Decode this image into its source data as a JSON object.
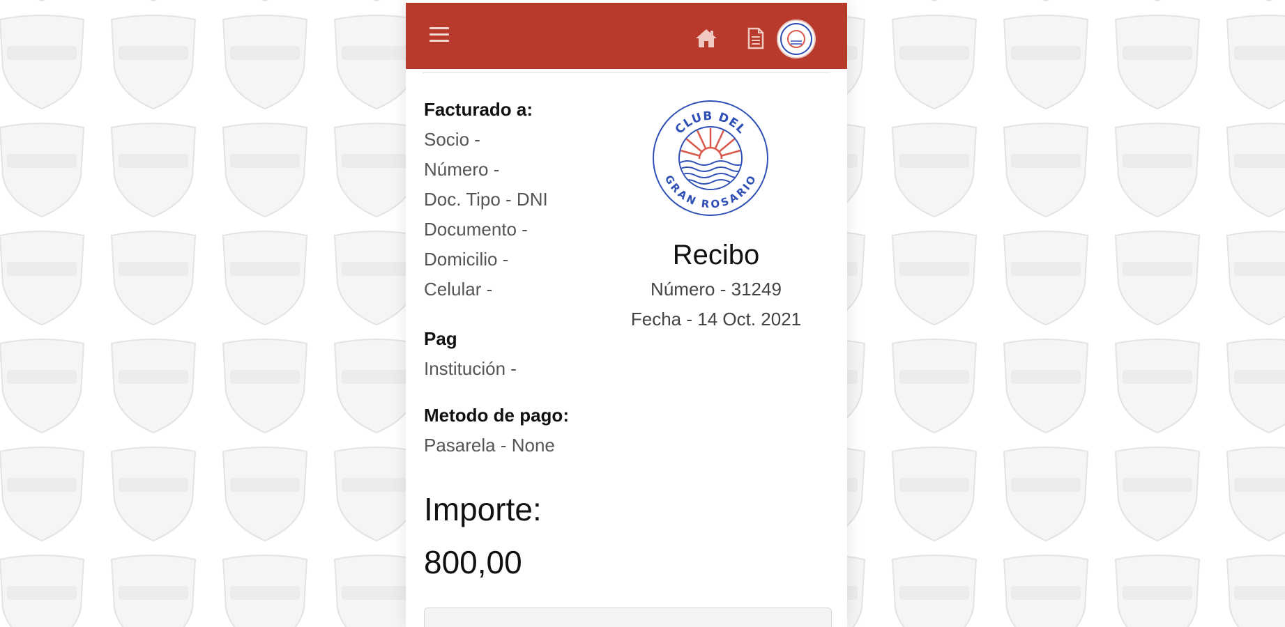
{
  "header": {
    "menu_icon": "hamburger-menu-icon",
    "home_icon": "home-icon",
    "document_icon": "document-icon",
    "avatar_icon": "club-avatar-icon",
    "background_color": "#b83a2c"
  },
  "billing": {
    "title": "Facturado a:",
    "lines": [
      "Socio -",
      "Número -",
      "Doc. Tipo - DNI",
      "Documento -",
      "Domicilio -",
      "Celular -"
    ]
  },
  "payer": {
    "title": "Pag",
    "lines": [
      "Institución -"
    ]
  },
  "payment_method": {
    "title": "Metodo de pago:",
    "lines": [
      "Pasarela - None"
    ]
  },
  "receipt": {
    "logo_text_top": "CLUB DEL",
    "logo_text_bottom": "GRAN ROSARIO",
    "title": "Recibo",
    "number": "Número - 31249",
    "date": "Fecha - 14 Oct. 2021"
  },
  "amount": {
    "label": "Importe:",
    "value": "800,00"
  },
  "colors": {
    "accent": "#b83a2c",
    "logo_blue": "#2e4fb5",
    "logo_red": "#d9584a"
  }
}
